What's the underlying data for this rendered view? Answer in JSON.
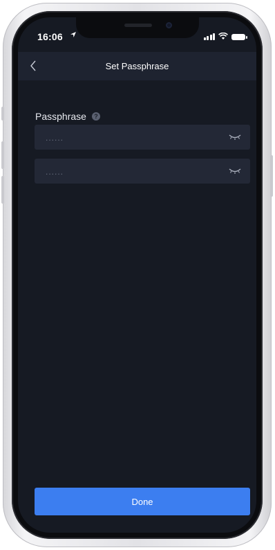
{
  "status_bar": {
    "time": "16:06",
    "location_arrow": "location-arrow-icon",
    "icons": [
      "signal-icon",
      "wifi-icon",
      "battery-icon"
    ]
  },
  "nav": {
    "back_icon": "chevron-left-icon",
    "title": "Set Passphrase"
  },
  "form": {
    "label": "Passphrase",
    "help_icon": "question-icon",
    "help_glyph": "?",
    "fields": [
      {
        "placeholder": "......",
        "toggle_icon": "eye-closed-icon"
      },
      {
        "placeholder": "......",
        "toggle_icon": "eye-closed-icon"
      }
    ]
  },
  "actions": {
    "done_label": "Done"
  },
  "colors": {
    "background": "#161a23",
    "navbar": "#1e2330",
    "field": "#232836",
    "accent": "#3c7ef0"
  }
}
